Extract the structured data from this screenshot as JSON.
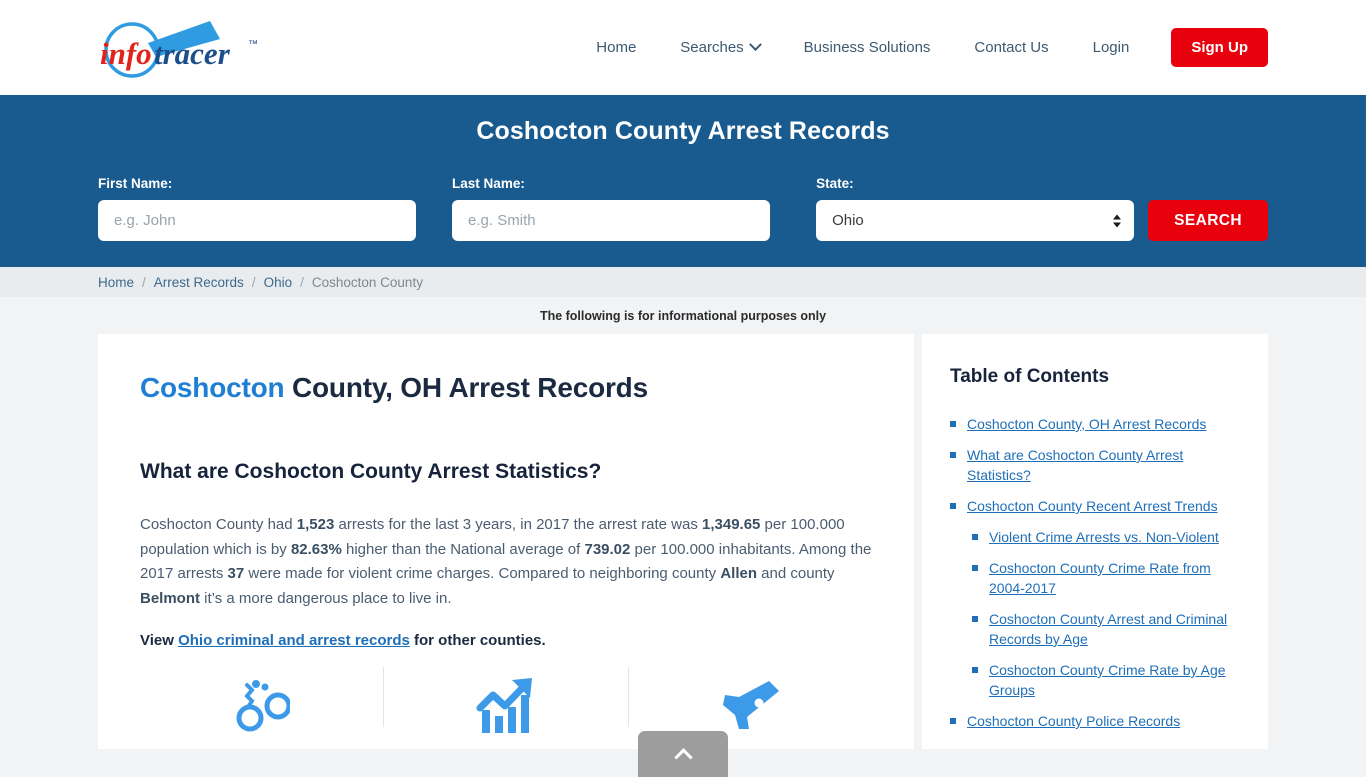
{
  "brand": {
    "name_part1": "info",
    "name_part2": "tracer",
    "trademark": "™",
    "color_red": "#e2231a",
    "color_blue": "#1c4f8a",
    "color_lens": "#2f9be0"
  },
  "nav": {
    "items": [
      {
        "label": "Home",
        "has_dropdown": false
      },
      {
        "label": "Searches",
        "has_dropdown": true
      },
      {
        "label": "Business Solutions",
        "has_dropdown": false
      },
      {
        "label": "Contact Us",
        "has_dropdown": false
      },
      {
        "label": "Login",
        "has_dropdown": false
      }
    ],
    "signup_label": "Sign Up",
    "signup_color": "#e8000d"
  },
  "hero": {
    "title": "Coshocton County Arrest Records",
    "background_color": "#1a5b8f",
    "first_name": {
      "label": "First Name:",
      "placeholder": "e.g. John",
      "value": ""
    },
    "last_name": {
      "label": "Last Name:",
      "placeholder": "e.g. Smith",
      "value": ""
    },
    "state": {
      "label": "State:",
      "value": "Ohio",
      "options": [
        "Ohio"
      ]
    },
    "search_label": "SEARCH"
  },
  "breadcrumb": {
    "items": [
      "Home",
      "Arrest Records",
      "Ohio"
    ],
    "current": "Coshocton County",
    "separator": "/"
  },
  "notice": "The following is for informational purposes only",
  "main": {
    "title_highlight": "Coshocton",
    "title_rest": " County, OH Arrest Records",
    "section_heading": "What are Coshocton County Arrest Statistics?",
    "paragraph": {
      "p1": "Coshocton County had ",
      "arrests_total": "1,523",
      "p2": " arrests for the last 3 years, in 2017 the arrest rate was ",
      "arrest_rate": "1,349.65",
      "p3": " per 100.000 population which is by ",
      "percent_higher": "82.63%",
      "p4": " higher than the National average of ",
      "national_average": "739.02",
      "p5": " per 100.000 inhabitants. Among the 2017 arrests ",
      "violent_arrests": "37",
      "p6": " were made for violent crime charges. Compared to neighboring county ",
      "neighbor_county_1": "Allen",
      "p7": " and county ",
      "neighbor_county_2": "Belmont",
      "p8": " it’s a more dangerous place to live in."
    },
    "view_line": {
      "prefix": "View ",
      "link_text": "Ohio criminal and arrest records",
      "suffix": " for other counties."
    },
    "icons": [
      {
        "name": "handcuffs-icon"
      },
      {
        "name": "trending-up-chart-icon"
      },
      {
        "name": "handgun-icon"
      }
    ]
  },
  "toc": {
    "title": "Table of Contents",
    "items": [
      {
        "label": "Coshocton County, OH Arrest Records",
        "children": []
      },
      {
        "label": "What are Coshocton County Arrest Statistics?",
        "children": []
      },
      {
        "label": "Coshocton County Recent Arrest Trends",
        "children": [
          {
            "label": "Violent Crime Arrests vs. Non-Violent"
          },
          {
            "label": "Coshocton County Crime Rate from 2004-2017"
          },
          {
            "label": "Coshocton County Arrest and Criminal Records by Age"
          },
          {
            "label": "Coshocton County Crime Rate by Age Groups"
          }
        ]
      },
      {
        "label": "Coshocton County Police Records",
        "children": []
      }
    ]
  },
  "scroll_top": {
    "name": "scroll-to-top-button"
  }
}
